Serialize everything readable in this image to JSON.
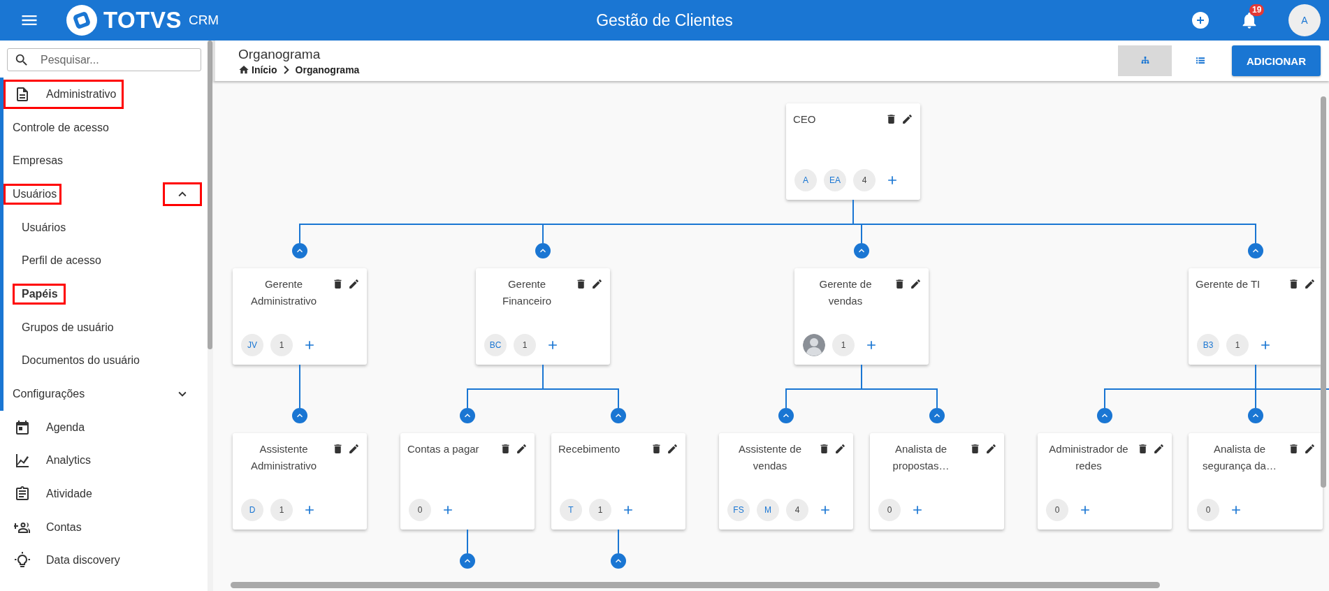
{
  "top_bar": {
    "brand": "TOTVS",
    "product": "CRM",
    "title": "Gestão de Clientes",
    "notifications": "19",
    "avatar": "A"
  },
  "page": {
    "title": "Organograma",
    "breadcrumb": [
      "Início",
      "Organograma"
    ],
    "views": [
      {
        "kind": "org",
        "selected": true
      },
      {
        "kind": "list",
        "selected": false
      }
    ],
    "add_button": "ADICIONAR"
  },
  "sidebar": {
    "search": {
      "placeholder": "Pesquisar..."
    },
    "items": [
      {
        "label": "Administrativo",
        "kind": "group",
        "expanded": true,
        "highlighted": true,
        "children": [
          {
            "label": "Controle de acesso",
            "kind": "link",
            "selected": false,
            "highlighted": false
          },
          {
            "label": "Empresas",
            "kind": "link",
            "selected": false,
            "highlighted": false
          },
          {
            "label": "Usuários",
            "kind": "group",
            "expanded": true,
            "highlighted": true,
            "children": [
              {
                "label": "Usuários",
                "selected": false,
                "highlighted": false
              },
              {
                "label": "Perfil de acesso",
                "selected": false,
                "highlighted": false
              },
              {
                "label": "Papéis",
                "selected": true,
                "highlighted": true
              },
              {
                "label": "Grupos de usuário",
                "selected": false,
                "highlighted": false
              },
              {
                "label": "Documentos do usuário",
                "selected": false,
                "highlighted": false
              }
            ]
          },
          {
            "label": "Configurações",
            "kind": "group",
            "expanded": false,
            "highlighted": false
          }
        ]
      },
      {
        "label": "Agenda",
        "kind": "link",
        "selected": false,
        "highlighted": false
      },
      {
        "label": "Analytics",
        "kind": "link",
        "selected": false,
        "highlighted": false
      },
      {
        "label": "Atividade",
        "kind": "link",
        "selected": false,
        "highlighted": false
      },
      {
        "label": "Contas",
        "kind": "link",
        "selected": false,
        "highlighted": false
      },
      {
        "label": "Data discovery",
        "kind": "link",
        "selected": false,
        "highlighted": false
      }
    ]
  },
  "chart": {
    "root": {
      "title": "CEO",
      "members": [
        {
          "kind": "initials",
          "text": "A"
        },
        {
          "kind": "initials",
          "text": "EA"
        },
        {
          "kind": "count",
          "text": "4"
        }
      ],
      "expanded": true,
      "children": [
        {
          "title": "Gerente Administrativo",
          "members": [
            {
              "kind": "initials",
              "text": "JV"
            },
            {
              "kind": "count",
              "text": "1"
            }
          ],
          "expanded": true,
          "children": [
            {
              "title": "Assistente Administrativo",
              "members": [
                {
                  "kind": "initials",
                  "text": "D"
                },
                {
                  "kind": "count",
                  "text": "1"
                }
              ],
              "expanded": false
            }
          ]
        },
        {
          "title": "Gerente Financeiro",
          "members": [
            {
              "kind": "initials",
              "text": "BC"
            },
            {
              "kind": "count",
              "text": "1"
            }
          ],
          "expanded": true,
          "children": [
            {
              "title": "Contas a pagar",
              "members": [
                {
                  "kind": "count",
                  "text": "0"
                }
              ],
              "expanded": true
            },
            {
              "title": "Recebimento",
              "members": [
                {
                  "kind": "initials",
                  "text": "T"
                },
                {
                  "kind": "count",
                  "text": "1"
                }
              ],
              "expanded": true
            }
          ]
        },
        {
          "title": "Gerente de vendas",
          "members": [
            {
              "kind": "photo"
            },
            {
              "kind": "count",
              "text": "1"
            }
          ],
          "expanded": true,
          "children": [
            {
              "title": "Assistente de vendas",
              "members": [
                {
                  "kind": "initials",
                  "text": "FS"
                },
                {
                  "kind": "initials",
                  "text": "M"
                },
                {
                  "kind": "count",
                  "text": "4"
                }
              ],
              "expanded": false
            },
            {
              "title": "Analista de propostas…",
              "members": [
                {
                  "kind": "count",
                  "text": "0"
                }
              ],
              "expanded": false
            }
          ]
        },
        {
          "title": "Gerente de TI",
          "members": [
            {
              "kind": "initials",
              "text": "B3"
            },
            {
              "kind": "count",
              "text": "1"
            }
          ],
          "expanded": true,
          "children_continue": true,
          "children": [
            {
              "title": "Administrador de redes",
              "members": [
                {
                  "kind": "count",
                  "text": "0"
                }
              ],
              "expanded": false
            },
            {
              "title": "Analista de segurança da…",
              "members": [
                {
                  "kind": "count",
                  "text": "0"
                }
              ],
              "expanded": false
            }
          ]
        }
      ]
    }
  }
}
